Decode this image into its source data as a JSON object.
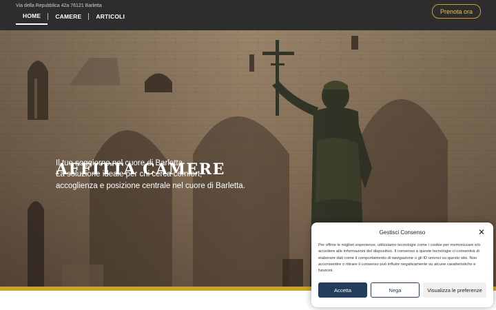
{
  "header": {
    "address": "Via della Repubblica 42a 76121 Barletta",
    "nav": [
      "HOME",
      "CAMERE",
      "ARTICOLI"
    ],
    "book_label": "Prenota ora"
  },
  "hero": {
    "title": "AFFITTA CAMERE",
    "lines": [
      "Il tuo soggiorno nel cuore di Barletta",
      "La soluzione ideale per chi cerca comfort,",
      "accoglienza e posizione centrale nel cuore di Barletta."
    ]
  },
  "consent": {
    "title": "Gestisci Consenso",
    "text": "Per offrire le migliori esperienze, utilizziamo tecnologie come i cookie per memorizzare e/o accedere alle informazioni del dispositivo. Il consenso a queste tecnologie ci consentirà di elaborare dati come il comportamento di navigazione o gli ID univoci su questo sito. Non acconsentire o ritirare il consenso può influire negativamente su alcune caratteristiche e funzioni.",
    "accept": "Accetta",
    "deny": "Nega",
    "prefs": "Visualizza le preferenze"
  },
  "colors": {
    "header_bg": "#2d2d2d",
    "accent_gold": "#c9a227",
    "consent_primary": "#243c5c"
  },
  "icons": [
    "close-icon"
  ]
}
